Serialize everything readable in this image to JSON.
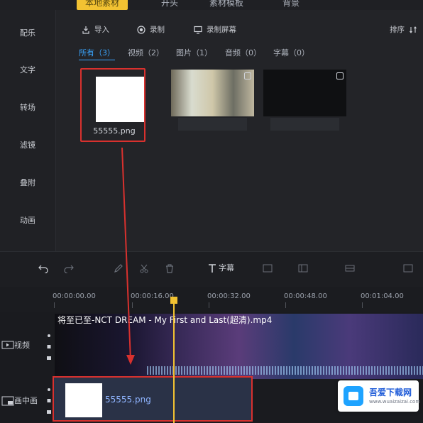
{
  "top_tabs": [
    "本地素材",
    "开头",
    "素材模板",
    "背景"
  ],
  "sidebar": {
    "items": [
      "配乐",
      "文字",
      "转场",
      "滤镜",
      "叠附",
      "动画"
    ]
  },
  "actions": {
    "import": "导入",
    "record": "录制",
    "record_screen": "录制屏幕",
    "sort": "排序"
  },
  "filters": [
    {
      "label": "所有（3）",
      "active": true
    },
    {
      "label": "视频（2）",
      "active": false
    },
    {
      "label": "图片（1）",
      "active": false
    },
    {
      "label": "音频（0）",
      "active": false
    },
    {
      "label": "字幕（0）",
      "active": false
    }
  ],
  "media": {
    "image_name": "55555.png"
  },
  "toolbar": {
    "subtitle_label": "字幕"
  },
  "ruler": {
    "ticks": [
      "00:00:00.00",
      "00:00:16.00",
      "00:00:32.00",
      "00:00:48.00",
      "00:01:04.00"
    ]
  },
  "tracks": {
    "video": {
      "label": "视频",
      "clip_title": "将至已至-NCT DREAM - My First and Last(超清).mp4"
    },
    "pip": {
      "label": "画中画",
      "clip_name": "55555.png"
    }
  },
  "watermark": {
    "title": "吾爱下载网",
    "url": "www.wuaizaizai.com"
  },
  "colors": {
    "accent": "#f2c232",
    "highlight": "#d8312e",
    "link": "#3aa6ff"
  }
}
